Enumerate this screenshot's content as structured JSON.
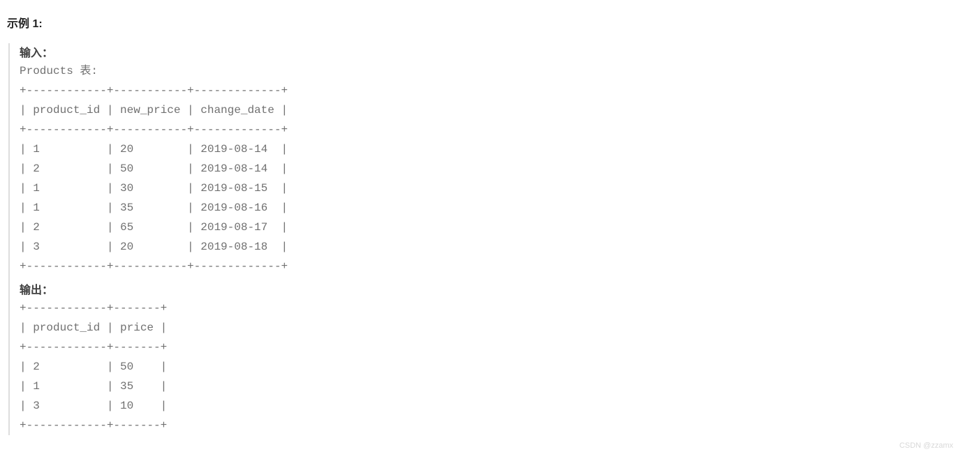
{
  "example_title": "示例 1:",
  "input_label": "输入：",
  "output_label": "输出：",
  "products_label_line": "Products 表:",
  "input_table": {
    "border_top": "+------------+-----------+-------------+",
    "header": "| product_id | new_price | change_date |",
    "border_mid": "+------------+-----------+-------------+",
    "rows": [
      "| 1          | 20        | 2019-08-14  |",
      "| 2          | 50        | 2019-08-14  |",
      "| 1          | 30        | 2019-08-15  |",
      "| 1          | 35        | 2019-08-16  |",
      "| 2          | 65        | 2019-08-17  |",
      "| 3          | 20        | 2019-08-18  |"
    ],
    "border_bot": "+------------+-----------+-------------+"
  },
  "output_table": {
    "border_top": "+------------+-------+",
    "header": "| product_id | price |",
    "border_mid": "+------------+-------+",
    "rows": [
      "| 2          | 50    |",
      "| 1          | 35    |",
      "| 3          | 10    |"
    ],
    "border_bot": "+------------+-------+"
  },
  "chart_data": {
    "type": "table",
    "tables": [
      {
        "name": "Products",
        "columns": [
          "product_id",
          "new_price",
          "change_date"
        ],
        "rows": [
          [
            1,
            20,
            "2019-08-14"
          ],
          [
            2,
            50,
            "2019-08-14"
          ],
          [
            1,
            30,
            "2019-08-15"
          ],
          [
            1,
            35,
            "2019-08-16"
          ],
          [
            2,
            65,
            "2019-08-17"
          ],
          [
            3,
            20,
            "2019-08-18"
          ]
        ]
      },
      {
        "name": "Output",
        "columns": [
          "product_id",
          "price"
        ],
        "rows": [
          [
            2,
            50
          ],
          [
            1,
            35
          ],
          [
            3,
            10
          ]
        ]
      }
    ]
  },
  "watermark": "CSDN @zzamx"
}
